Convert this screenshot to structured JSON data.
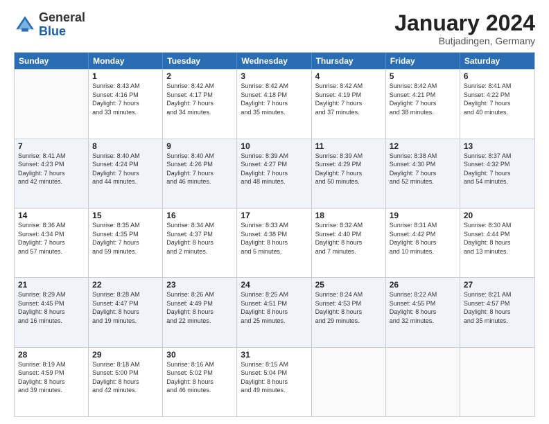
{
  "header": {
    "logo": {
      "general": "General",
      "blue": "Blue",
      "icon": "▶"
    },
    "title": "January 2024",
    "location": "Butjadingen, Germany"
  },
  "calendar": {
    "day_labels": [
      "Sunday",
      "Monday",
      "Tuesday",
      "Wednesday",
      "Thursday",
      "Friday",
      "Saturday"
    ],
    "weeks": [
      [
        {
          "num": "",
          "info": "",
          "empty": true
        },
        {
          "num": "1",
          "info": "Sunrise: 8:43 AM\nSunset: 4:16 PM\nDaylight: 7 hours\nand 33 minutes."
        },
        {
          "num": "2",
          "info": "Sunrise: 8:42 AM\nSunset: 4:17 PM\nDaylight: 7 hours\nand 34 minutes."
        },
        {
          "num": "3",
          "info": "Sunrise: 8:42 AM\nSunset: 4:18 PM\nDaylight: 7 hours\nand 35 minutes."
        },
        {
          "num": "4",
          "info": "Sunrise: 8:42 AM\nSunset: 4:19 PM\nDaylight: 7 hours\nand 37 minutes."
        },
        {
          "num": "5",
          "info": "Sunrise: 8:42 AM\nSunset: 4:21 PM\nDaylight: 7 hours\nand 38 minutes."
        },
        {
          "num": "6",
          "info": "Sunrise: 8:41 AM\nSunset: 4:22 PM\nDaylight: 7 hours\nand 40 minutes."
        }
      ],
      [
        {
          "num": "7",
          "info": "Sunrise: 8:41 AM\nSunset: 4:23 PM\nDaylight: 7 hours\nand 42 minutes."
        },
        {
          "num": "8",
          "info": "Sunrise: 8:40 AM\nSunset: 4:24 PM\nDaylight: 7 hours\nand 44 minutes."
        },
        {
          "num": "9",
          "info": "Sunrise: 8:40 AM\nSunset: 4:26 PM\nDaylight: 7 hours\nand 46 minutes."
        },
        {
          "num": "10",
          "info": "Sunrise: 8:39 AM\nSunset: 4:27 PM\nDaylight: 7 hours\nand 48 minutes."
        },
        {
          "num": "11",
          "info": "Sunrise: 8:39 AM\nSunset: 4:29 PM\nDaylight: 7 hours\nand 50 minutes."
        },
        {
          "num": "12",
          "info": "Sunrise: 8:38 AM\nSunset: 4:30 PM\nDaylight: 7 hours\nand 52 minutes."
        },
        {
          "num": "13",
          "info": "Sunrise: 8:37 AM\nSunset: 4:32 PM\nDaylight: 7 hours\nand 54 minutes."
        }
      ],
      [
        {
          "num": "14",
          "info": "Sunrise: 8:36 AM\nSunset: 4:34 PM\nDaylight: 7 hours\nand 57 minutes."
        },
        {
          "num": "15",
          "info": "Sunrise: 8:35 AM\nSunset: 4:35 PM\nDaylight: 7 hours\nand 59 minutes."
        },
        {
          "num": "16",
          "info": "Sunrise: 8:34 AM\nSunset: 4:37 PM\nDaylight: 8 hours\nand 2 minutes."
        },
        {
          "num": "17",
          "info": "Sunrise: 8:33 AM\nSunset: 4:38 PM\nDaylight: 8 hours\nand 5 minutes."
        },
        {
          "num": "18",
          "info": "Sunrise: 8:32 AM\nSunset: 4:40 PM\nDaylight: 8 hours\nand 7 minutes."
        },
        {
          "num": "19",
          "info": "Sunrise: 8:31 AM\nSunset: 4:42 PM\nDaylight: 8 hours\nand 10 minutes."
        },
        {
          "num": "20",
          "info": "Sunrise: 8:30 AM\nSunset: 4:44 PM\nDaylight: 8 hours\nand 13 minutes."
        }
      ],
      [
        {
          "num": "21",
          "info": "Sunrise: 8:29 AM\nSunset: 4:45 PM\nDaylight: 8 hours\nand 16 minutes."
        },
        {
          "num": "22",
          "info": "Sunrise: 8:28 AM\nSunset: 4:47 PM\nDaylight: 8 hours\nand 19 minutes."
        },
        {
          "num": "23",
          "info": "Sunrise: 8:26 AM\nSunset: 4:49 PM\nDaylight: 8 hours\nand 22 minutes."
        },
        {
          "num": "24",
          "info": "Sunrise: 8:25 AM\nSunset: 4:51 PM\nDaylight: 8 hours\nand 25 minutes."
        },
        {
          "num": "25",
          "info": "Sunrise: 8:24 AM\nSunset: 4:53 PM\nDaylight: 8 hours\nand 29 minutes."
        },
        {
          "num": "26",
          "info": "Sunrise: 8:22 AM\nSunset: 4:55 PM\nDaylight: 8 hours\nand 32 minutes."
        },
        {
          "num": "27",
          "info": "Sunrise: 8:21 AM\nSunset: 4:57 PM\nDaylight: 8 hours\nand 35 minutes."
        }
      ],
      [
        {
          "num": "28",
          "info": "Sunrise: 8:19 AM\nSunset: 4:59 PM\nDaylight: 8 hours\nand 39 minutes."
        },
        {
          "num": "29",
          "info": "Sunrise: 8:18 AM\nSunset: 5:00 PM\nDaylight: 8 hours\nand 42 minutes."
        },
        {
          "num": "30",
          "info": "Sunrise: 8:16 AM\nSunset: 5:02 PM\nDaylight: 8 hours\nand 46 minutes."
        },
        {
          "num": "31",
          "info": "Sunrise: 8:15 AM\nSunset: 5:04 PM\nDaylight: 8 hours\nand 49 minutes."
        },
        {
          "num": "",
          "info": "",
          "empty": true
        },
        {
          "num": "",
          "info": "",
          "empty": true
        },
        {
          "num": "",
          "info": "",
          "empty": true
        }
      ]
    ]
  }
}
